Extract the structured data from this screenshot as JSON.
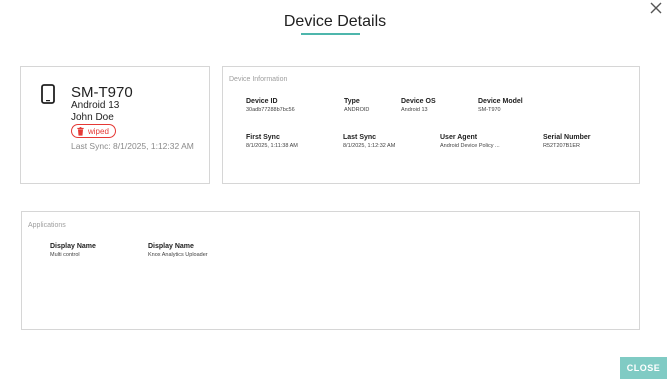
{
  "dialog": {
    "title": "Device Details",
    "close_label": "CLOSE",
    "accent_color": "#4db6ac"
  },
  "device": {
    "model": "SM-T970",
    "os": "Android 13",
    "user": "John Doe",
    "status": "wiped",
    "status_color": "#e53935",
    "last_sync": "Last Sync: 8/1/2025, 1:12:32 AM"
  },
  "device_information": {
    "section_label": "Device Information",
    "fields": [
      {
        "label": "Device ID",
        "value": "30adb77288b7bc56"
      },
      {
        "label": "Type",
        "value": "ANDROID"
      },
      {
        "label": "Device OS",
        "value": "Android 13"
      },
      {
        "label": "Device Model",
        "value": "SM-T970"
      },
      {
        "label": "First Sync",
        "value": "8/1/2025, 1:11:38 AM"
      },
      {
        "label": "Last Sync",
        "value": "8/1/2025, 1:12:32 AM"
      },
      {
        "label": "User Agent",
        "value": "Android Device Policy ..."
      },
      {
        "label": "Serial Number",
        "value": "R52T207B1ER"
      }
    ]
  },
  "applications": {
    "section_label": "Applications",
    "items": [
      {
        "label": "Display Name",
        "value": "Multi control"
      },
      {
        "label": "Display Name",
        "value": "Knox Analytics Uploader"
      }
    ]
  }
}
